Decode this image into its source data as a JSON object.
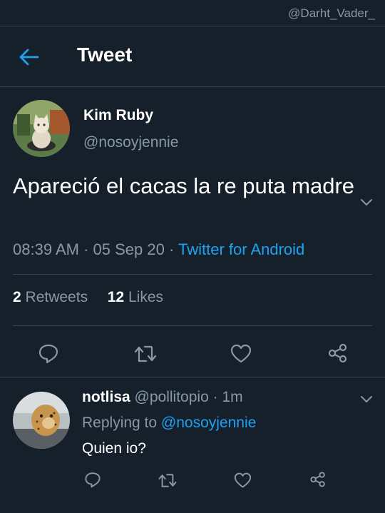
{
  "watermark": "@Darht_Vader_",
  "header": {
    "title": "Tweet",
    "back_icon": "arrow-left-icon"
  },
  "tweet": {
    "author_name": "Kim Ruby",
    "author_handle": "@nosoyjennie",
    "text": "Apareció el cacas la re puta madre",
    "time": "08:39 AM",
    "date": "05 Sep 20",
    "source": "Twitter for Android",
    "retweet_count": "2",
    "retweet_label": "Retweets",
    "like_count": "12",
    "like_label": "Likes",
    "actions": [
      "reply-icon",
      "retweet-icon",
      "like-icon",
      "share-icon"
    ]
  },
  "reply": {
    "author_name": "notlisa",
    "author_handle": "@pollitopio",
    "time": "1m",
    "replying_label": "Replying to",
    "replying_to": "@nosoyjennie",
    "text": "Quien io?",
    "actions": [
      "reply-icon",
      "retweet-icon",
      "like-icon",
      "share-icon"
    ]
  },
  "colors": {
    "background": "#15202b",
    "border": "#38444d",
    "secondary_text": "#8899a6",
    "accent": "#1da1f2"
  }
}
